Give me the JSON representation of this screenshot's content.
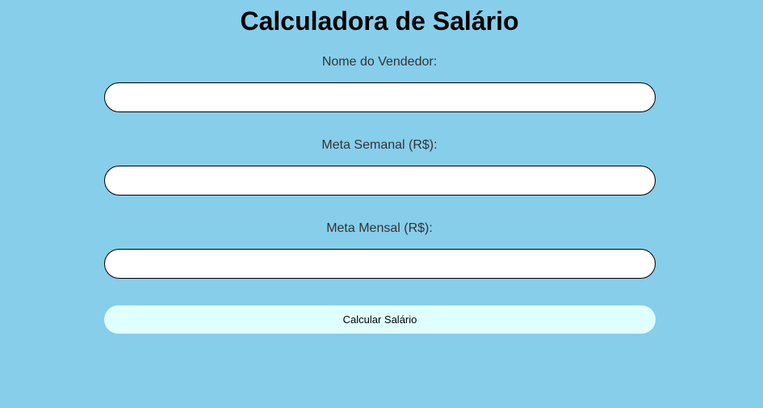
{
  "page": {
    "title": "Calculadora de Salário"
  },
  "form": {
    "seller_name": {
      "label": "Nome do Vendedor:",
      "value": "",
      "placeholder": ""
    },
    "weekly_goal": {
      "label": "Meta Semanal (R$):",
      "value": "",
      "placeholder": ""
    },
    "monthly_goal": {
      "label": "Meta Mensal (R$):",
      "value": "",
      "placeholder": ""
    },
    "submit_label": "Calcular Salário"
  },
  "colors": {
    "background": "#87ceeb",
    "input_background": "#ffffff",
    "button_background": "#e0ffff",
    "label_text": "#333333"
  }
}
